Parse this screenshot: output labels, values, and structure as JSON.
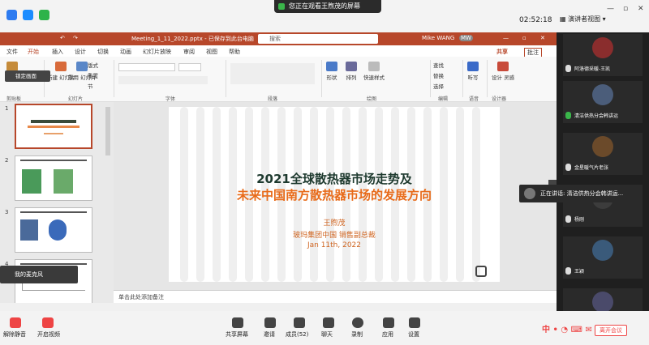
{
  "meeting": {
    "banner": "您正在观看王煦茂的屏幕",
    "clock": "02:52:18",
    "view_label": "演讲者视图",
    "lock_screen": "锁定画面",
    "speaking": "正在讲话: 清洁供热分会韩讲运...",
    "self_label": "我的麦克风"
  },
  "ppt": {
    "filename": "Meeting_1_11_2022.pptx - 已保存到此台电脑",
    "search_placeholder": "搜索",
    "user": "Mike WANG",
    "user_initials": "MW",
    "share": "共享",
    "comments": "批注",
    "tabs": [
      "文件",
      "开始",
      "插入",
      "设计",
      "切换",
      "动画",
      "幻灯片放映",
      "审阅",
      "视图",
      "帮助"
    ],
    "ribbon": {
      "paste": "粘贴",
      "new_slide": "新建\n幻灯片",
      "reuse_slide": "重用\n幻灯片",
      "layout": "版式",
      "reset": "重置",
      "section": "节",
      "shapes": "形状",
      "arrange": "排列",
      "quick_styles": "快速样式",
      "find": "查找",
      "replace": "替换",
      "select": "选择",
      "dictate": "听写",
      "designer": "设计\n灵感",
      "groups": [
        "剪贴板",
        "幻灯片",
        "字体",
        "段落",
        "绘图",
        "编辑",
        "语音",
        "设计器"
      ]
    },
    "thumb_numbers": [
      "1",
      "2",
      "3",
      "4"
    ],
    "notes_placeholder": "单击此处添加备注"
  },
  "slide": {
    "title_line1": "2021全球散热器市场走势及",
    "title_line2": "未来中国南方散热器市场的发展方向",
    "presenter": "王煦茂",
    "company": "玻玛集团中国 销售副总裁",
    "date": "Jan 11th, 2022",
    "logo_char": "Ⓟ"
  },
  "participants": [
    {
      "name": "阿洛德采暖-王凯",
      "color": "#8a2d2d"
    },
    {
      "name": "清洁供热分会韩讲运",
      "color": "#4b5d7a"
    },
    {
      "name": "金星暖气片老张",
      "color": "#6b4a2a"
    },
    {
      "name": "杨刚",
      "color": "#3c3c3c"
    },
    {
      "name": "王颖",
      "color": "#3a5a7a"
    },
    {
      "name": "",
      "color": "#4a4a6a"
    }
  ],
  "toolbar": {
    "mute": "解除静音",
    "video": "开启视频",
    "share_screen": "共享屏幕",
    "invite": "邀请",
    "members": "成员(52)",
    "chat": "聊天",
    "record": "录制",
    "apps": "应用",
    "settings": "设置",
    "end": "离开会议",
    "ime": "中"
  }
}
